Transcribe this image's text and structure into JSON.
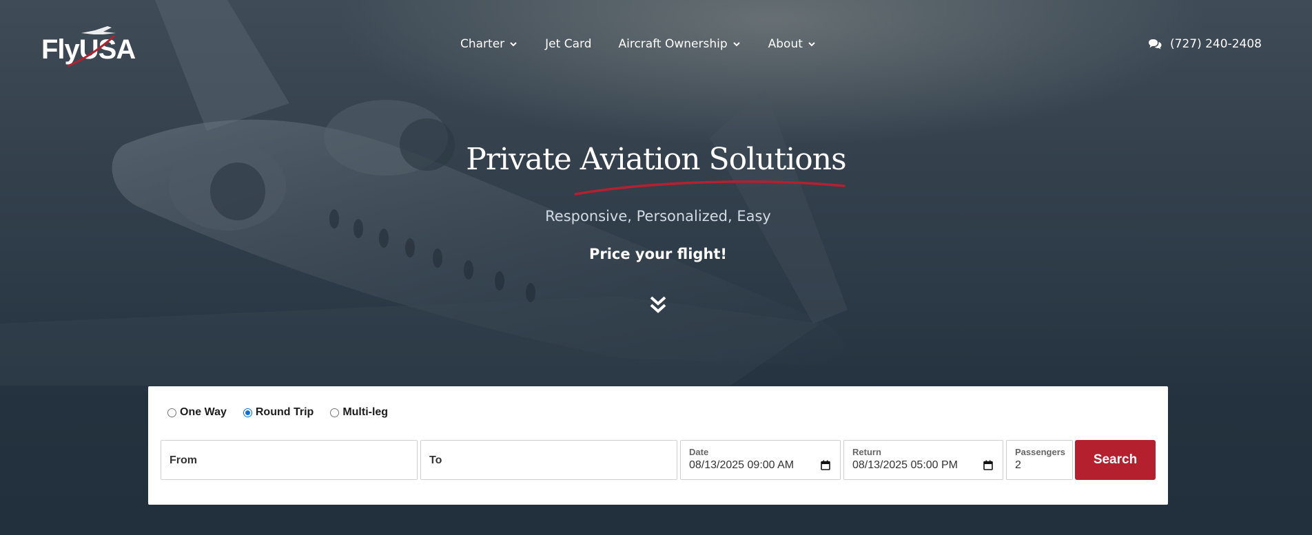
{
  "brand": {
    "logo_text": "FlyUSA"
  },
  "nav": {
    "items": [
      {
        "label": "Charter",
        "has_dropdown": true
      },
      {
        "label": "Jet Card",
        "has_dropdown": false
      },
      {
        "label": "Aircraft Ownership",
        "has_dropdown": true
      },
      {
        "label": "About",
        "has_dropdown": true
      }
    ],
    "phone": "(727) 240-2408"
  },
  "hero": {
    "title": "Private Aviation Solutions",
    "subtitle": "Responsive, Personalized, Easy",
    "cta": "Price your flight!"
  },
  "search": {
    "trip_types": [
      {
        "label": "One Way",
        "checked": false
      },
      {
        "label": "Round Trip",
        "checked": true
      },
      {
        "label": "Multi-leg",
        "checked": false
      }
    ],
    "from_placeholder": "From",
    "to_placeholder": "To",
    "date_label": "Date",
    "date_value": "08/13/2025 09:00  AM",
    "return_label": "Return",
    "return_value": "08/13/2025 05:00  PM",
    "passengers_label": "Passengers",
    "passengers_value": "2",
    "search_label": "Search"
  },
  "colors": {
    "accent": "#b5202e",
    "radio_checked": "#0b6fd6",
    "background": "#22303d"
  },
  "icons": {
    "nav_dropdown": "chevron-down-icon",
    "phone": "chat-bubbles-icon",
    "scroll": "double-chevron-down-icon",
    "date": "calendar-icon"
  }
}
